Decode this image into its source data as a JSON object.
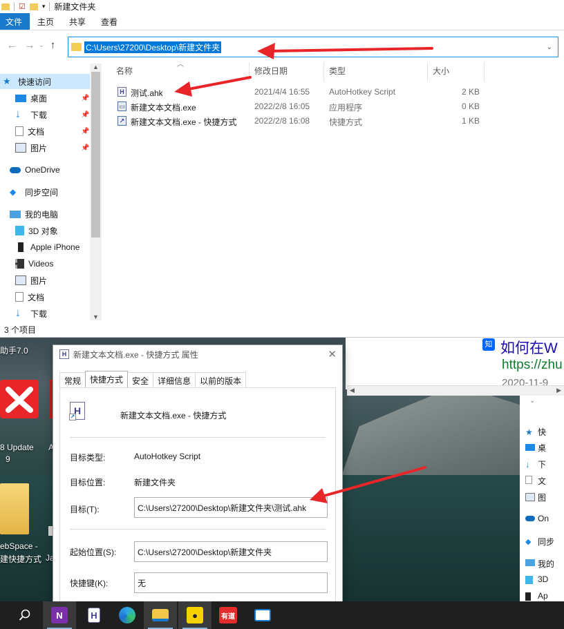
{
  "explorer": {
    "window_title": "新建文件夹",
    "ribbon_tabs": [
      "文件",
      "主页",
      "共享",
      "查看"
    ],
    "address": "C:\\Users\\27200\\Desktop\\新建文件夹",
    "columns": [
      "名称",
      "修改日期",
      "类型",
      "大小"
    ],
    "files": [
      {
        "name": "测试.ahk",
        "date": "2021/4/4 16:55",
        "type": "AutoHotkey Script",
        "size": "2 KB"
      },
      {
        "name": "新建文本文档.exe",
        "date": "2022/2/8 16:05",
        "type": "应用程序",
        "size": "0 KB"
      },
      {
        "name": "新建文本文档.exe - 快捷方式",
        "date": "2022/2/8 16:08",
        "type": "快捷方式",
        "size": "1 KB"
      }
    ],
    "sidebar": [
      {
        "label": "快速访问",
        "icon": "star-icon"
      },
      {
        "label": "桌面",
        "icon": "desktop-icon",
        "pinned": true
      },
      {
        "label": "下载",
        "icon": "download-icon",
        "pinned": true
      },
      {
        "label": "文档",
        "icon": "document-icon",
        "pinned": true
      },
      {
        "label": "图片",
        "icon": "picture-icon",
        "pinned": true
      },
      {
        "label": "OneDrive",
        "icon": "cloud-icon"
      },
      {
        "label": "同步空间",
        "icon": "sync-icon"
      },
      {
        "label": "我的电脑",
        "icon": "computer-icon"
      },
      {
        "label": "3D 对象",
        "icon": "cube-icon"
      },
      {
        "label": "Apple iPhone",
        "icon": "phone-icon"
      },
      {
        "label": "Videos",
        "icon": "video-icon"
      },
      {
        "label": "图片",
        "icon": "picture-icon"
      },
      {
        "label": "文档",
        "icon": "document-icon"
      },
      {
        "label": "下载",
        "icon": "download-icon"
      }
    ],
    "status": "3 个项目"
  },
  "dialog": {
    "title": "新建文本文档.exe - 快捷方式 属性",
    "tabs": [
      "常规",
      "快捷方式",
      "安全",
      "详细信息",
      "以前的版本"
    ],
    "active_tab": "快捷方式",
    "name": "新建文本文档.exe - 快捷方式",
    "target_type_label": "目标类型:",
    "target_type": "AutoHotkey Script",
    "target_location_label": "目标位置:",
    "target_location": "新建文件夹",
    "target_label": "目标(T):",
    "target": "C:\\Users\\27200\\Desktop\\新建文件夹\\测试.ahk",
    "start_in_label": "起始位置(S):",
    "start_in": "C:\\Users\\27200\\Desktop\\新建文件夹",
    "hotkey_label": "快捷键(K):",
    "hotkey": "无"
  },
  "desktop": {
    "labels": [
      "助手7.0",
      "8 Update",
      "9",
      "A",
      "ebSpace -",
      "建快捷方式",
      "Ja"
    ]
  },
  "browser": {
    "title": "如何在W",
    "url": "https://zhu",
    "date": "2020-11-9",
    "zhi_icon": "知"
  },
  "right_explorer": {
    "items": [
      "快",
      "桌",
      "下",
      "文",
      "图",
      "On",
      "同步",
      "我的",
      "3D",
      "Ap"
    ]
  },
  "taskbar": {
    "items": [
      {
        "name": "search",
        "label": ""
      },
      {
        "name": "onenote",
        "label": "N"
      },
      {
        "name": "autohotkey",
        "label": "H"
      },
      {
        "name": "edge",
        "label": ""
      },
      {
        "name": "file-explorer",
        "label": ""
      },
      {
        "name": "app-yellow",
        "label": ""
      },
      {
        "name": "youdao",
        "label": "有道"
      },
      {
        "name": "app-blue",
        "label": ""
      }
    ]
  },
  "colors": {
    "accent": "#1979ca",
    "annotation": "#e8262a",
    "selection": "#0078d7"
  }
}
